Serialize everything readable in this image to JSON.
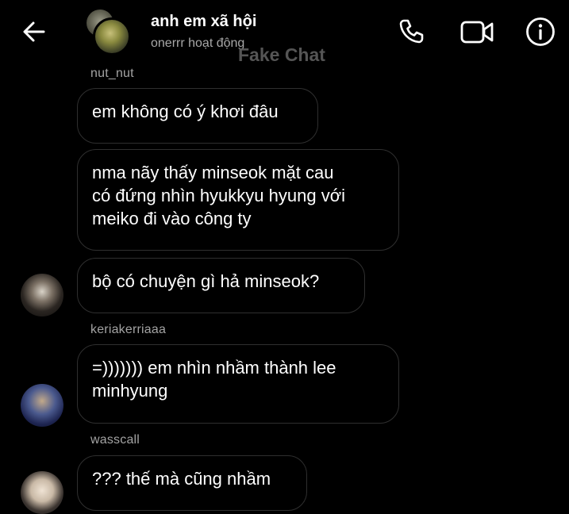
{
  "header": {
    "title": "anh em xã hội",
    "status": "onerrr hoạt động",
    "watermark": "Fake Chat"
  },
  "messages": [
    {
      "sender": "nut_nut",
      "lines": [
        "em không có ý khơi đâu"
      ]
    },
    {
      "sender": "",
      "lines": [
        "nma nãy thấy minseok mặt cau",
        "có đứng nhìn hyukkyu hyung với",
        "meiko đi vào công ty"
      ]
    },
    {
      "sender": "",
      "lines": [
        "bộ có chuyện gì hả minseok?"
      ]
    },
    {
      "sender": "keriakerriaaa",
      "lines": [
        "=))))))) em nhìn nhầm thành lee",
        "minhyung"
      ]
    },
    {
      "sender": "wasscall",
      "lines": [
        "??? thế mà cũng nhầm"
      ]
    }
  ]
}
